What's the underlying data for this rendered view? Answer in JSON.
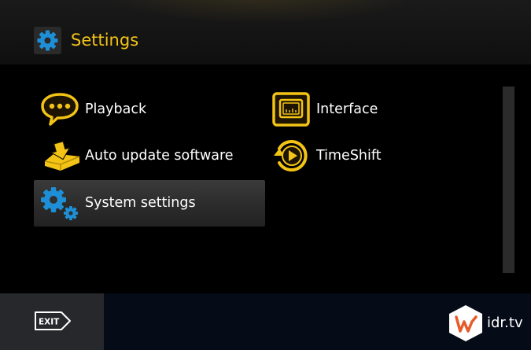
{
  "header": {
    "title": "Settings",
    "icon": "gear-icon"
  },
  "menu": {
    "items": [
      {
        "label": "Playback",
        "icon": "speech-bubble-icon"
      },
      {
        "label": "Interface",
        "icon": "tv-screen-icon"
      },
      {
        "label": "Auto update software",
        "icon": "set-top-box-download-icon"
      },
      {
        "label": "TimeShift",
        "icon": "timeshift-play-icon"
      },
      {
        "label": "System settings",
        "icon": "system-gears-icon",
        "selected": true
      }
    ]
  },
  "footer": {
    "exit_label": "EXIT",
    "watermark_text": "idr.tv"
  },
  "colors": {
    "accent": "#f3c316",
    "icon_blue": "#1e8fd6",
    "footer_bg": "#060b18"
  }
}
